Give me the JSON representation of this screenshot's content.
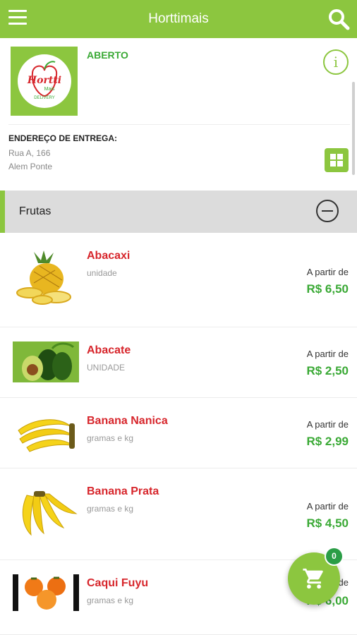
{
  "app_bar": {
    "title": "Horttimais"
  },
  "store": {
    "logo_name": "Hortti",
    "logo_sub": "Mais",
    "logo_tag": "DELIVERY",
    "status": "ABERTO",
    "address_label": "ENDEREÇO DE ENTREGA:",
    "address_line1": "Rua A, 166",
    "address_line2": "Alem Ponte"
  },
  "category": {
    "name": "Frutas"
  },
  "products": [
    {
      "name": "Abacaxi",
      "unit": "unidade",
      "from_label": "A partir de",
      "price": "R$ 6,50"
    },
    {
      "name": "Abacate",
      "unit": "UNIDADE",
      "from_label": "A partir de",
      "price": "R$ 2,50"
    },
    {
      "name": "Banana Nanica",
      "unit": "gramas e kg",
      "from_label": "A partir de",
      "price": "R$ 2,99"
    },
    {
      "name": "Banana Prata",
      "unit": "gramas e kg",
      "from_label": "A partir de",
      "price": "R$ 4,50"
    },
    {
      "name": "Caqui Fuyu",
      "unit": "gramas e kg",
      "from_label": "A partir de",
      "price": "R$ 6,00"
    }
  ],
  "cart": {
    "count": "0"
  },
  "colors": {
    "brand_green": "#8cc63f",
    "price_green": "#3aa935",
    "product_red": "#d7262c"
  },
  "icons": [
    "menu-icon",
    "search-icon",
    "info-icon",
    "grid-icon",
    "collapse-icon",
    "cart-icon"
  ]
}
